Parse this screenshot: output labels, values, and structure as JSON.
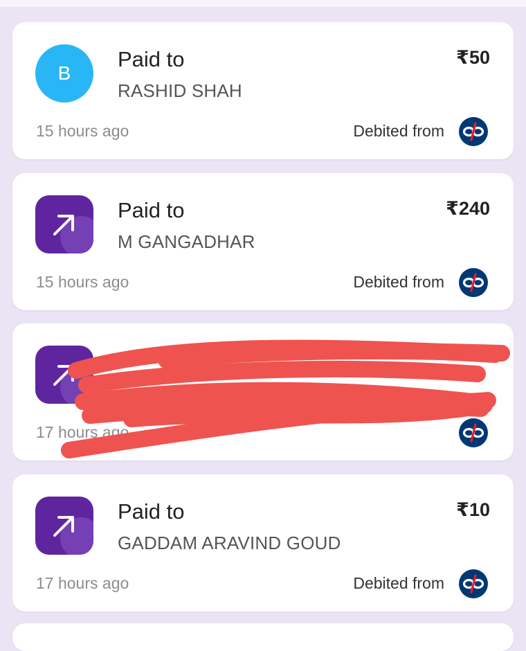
{
  "transactions": [
    {
      "avatar_type": "letter",
      "avatar_letter": "B",
      "avatar_color": "#29b6f6",
      "label": "Paid to",
      "name": "RASHID SHAH",
      "amount": "₹50",
      "time": "15 hours ago",
      "debited_label": "Debited from",
      "bank_icon": "kotak-bank-icon"
    },
    {
      "avatar_type": "app",
      "avatar_icon": "arrow-up-right-icon",
      "avatar_color": "#5f259f",
      "label": "Paid to",
      "name": "M GANGADHAR",
      "amount": "₹240",
      "time": "15 hours ago",
      "debited_label": "Debited from",
      "bank_icon": "kotak-bank-icon"
    },
    {
      "avatar_type": "app",
      "avatar_icon": "arrow-up-right-icon",
      "avatar_color": "#5f259f",
      "time": "17 hours ago",
      "bank_icon": "kotak-bank-icon",
      "redacted": true,
      "redaction_color": "#ef5350"
    },
    {
      "avatar_type": "app",
      "avatar_icon": "arrow-up-right-icon",
      "avatar_color": "#5f259f",
      "label": "Paid to",
      "name": "GADDAM ARAVIND GOUD",
      "amount": "₹10",
      "time": "17 hours ago",
      "debited_label": "Debited from",
      "bank_icon": "kotak-bank-icon"
    }
  ],
  "colors": {
    "page_background": "#ebe4f5",
    "card_background": "#ffffff",
    "brand_purple": "#5f259f",
    "bank_logo_blue": "#003874",
    "bank_logo_red": "#ed1c24"
  }
}
